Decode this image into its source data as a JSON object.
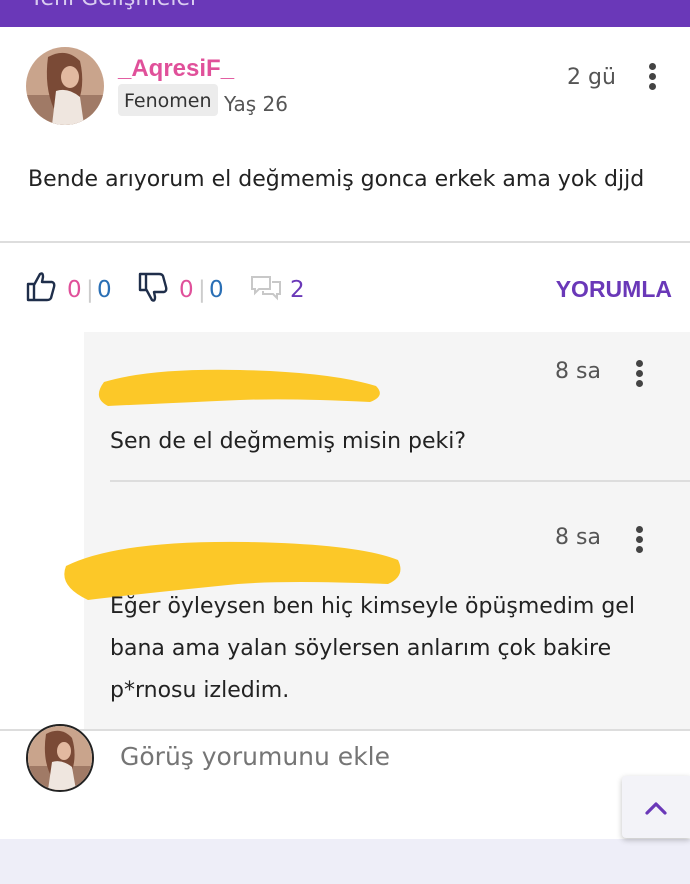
{
  "header": {
    "title": "Yeni Gelişmeler"
  },
  "post": {
    "username": "_AqresiF_",
    "badge": "Fenomen",
    "age": "Yaş 26",
    "time": "2 gü",
    "text": "Bende arıyorum el değmemiş gonca erkek ama yok djjd",
    "likes_a": "0",
    "likes_b": "0",
    "dislikes_a": "0",
    "dislikes_b": "0",
    "comments": "2",
    "comment_button": "YORUMLA",
    "separator": "|"
  },
  "replies": [
    {
      "time": "8 sa",
      "text": "Sen de el değmemiş misin peki?"
    },
    {
      "time": "8 sa",
      "lines": [
        "Eğer öyleysen ben hiç kimseyle öpüşmedim gel",
        "bana ama yalan söylersen anlarım çok bakire",
        "p*rnosu izledim."
      ]
    }
  ],
  "comment_box": {
    "placeholder": "Görüş yorumunu ekle"
  },
  "icons": {
    "like": "thumbs-up-icon",
    "dislike": "thumbs-down-icon",
    "comments": "speech-bubbles-icon",
    "more": "kebab-icon",
    "scroll": "chevron-up-icon"
  },
  "colors": {
    "brand": "#6a38b8",
    "username": "#e0509a",
    "redaction": "#fcc828"
  }
}
